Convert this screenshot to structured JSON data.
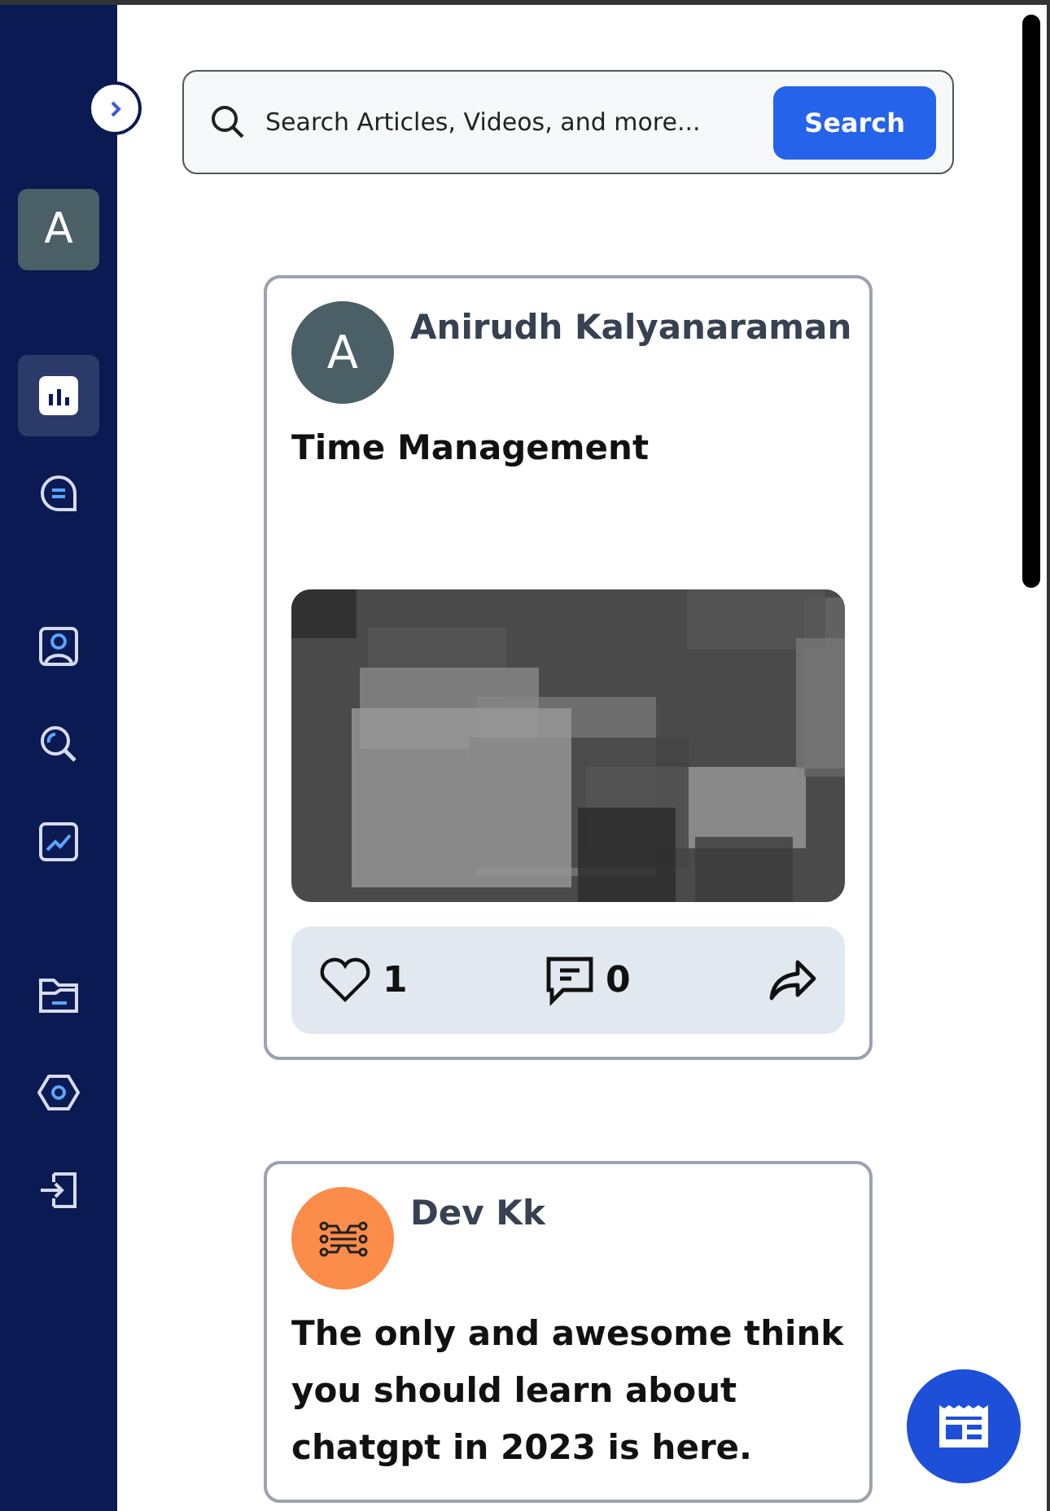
{
  "sidebar": {
    "avatar": "A",
    "nav_groups": [
      [
        {
          "kind": "dashboard",
          "selected": true
        },
        {
          "kind": "chat",
          "selected": false
        }
      ],
      [
        {
          "kind": "profile",
          "selected": false
        },
        {
          "kind": "explore",
          "selected": false
        },
        {
          "kind": "analytics",
          "selected": false
        }
      ],
      [
        {
          "kind": "folder",
          "selected": false
        },
        {
          "kind": "settings",
          "selected": false
        },
        {
          "kind": "logout",
          "selected": false
        }
      ]
    ]
  },
  "search": {
    "placeholder": "Search Articles, Videos, and more...",
    "button": "Search"
  },
  "posts": [
    {
      "author": "Anirudh Kalyanaraman",
      "avatar": {
        "kind": "letter",
        "text": "A"
      },
      "title": "Time Management",
      "likes": "1",
      "comments": "0"
    },
    {
      "author": "Dev Kk",
      "avatar": {
        "kind": "circuit"
      },
      "title": "The only and awesome think you should learn about chatgpt in 2023 is here."
    }
  ]
}
